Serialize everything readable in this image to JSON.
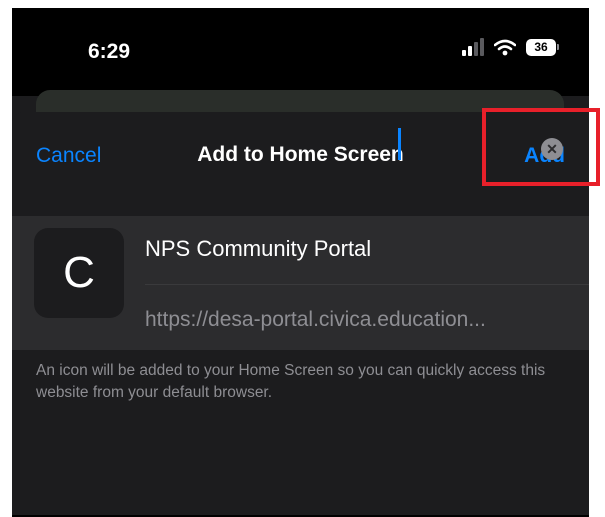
{
  "status_bar": {
    "time": "6:29",
    "battery_level": "36",
    "signal_bars_active": 2,
    "signal_bars_total": 4
  },
  "nav": {
    "cancel_label": "Cancel",
    "title": "Add to Home Screen",
    "add_label": "Add"
  },
  "form": {
    "icon_letter": "C",
    "name_value": "NPS Community Portal",
    "url": "https://desa-portal.civica.education..."
  },
  "footnote": "An icon will be added to your Home Screen so you can quickly access this website from your default browser.",
  "colors": {
    "accent": "#0a84ff",
    "highlight": "#e8202a",
    "sheet_bg": "#1c1c1e",
    "card_bg": "#2c2c2e"
  },
  "icons": [
    "signal-icon",
    "wifi-icon",
    "battery-icon",
    "clear-icon"
  ]
}
